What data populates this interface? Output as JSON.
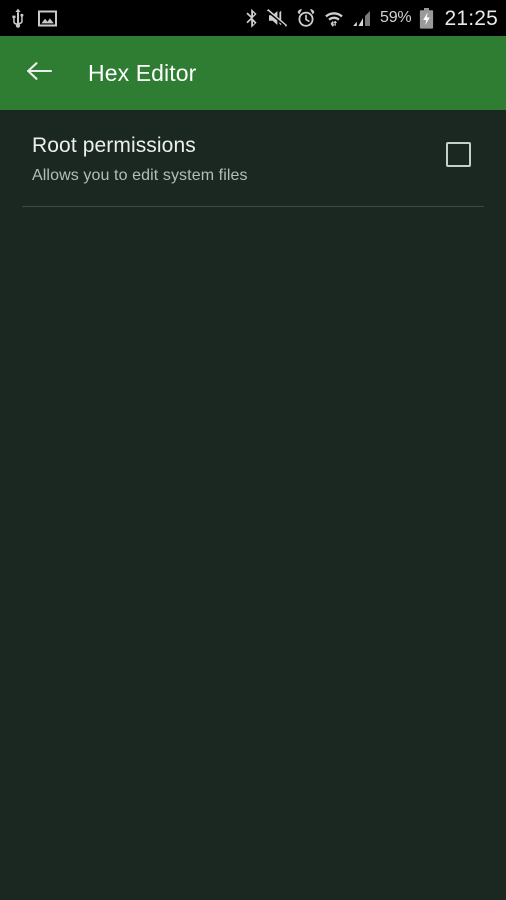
{
  "status_bar": {
    "left_icons": [
      {
        "name": "usb-icon",
        "label": "USB connected"
      },
      {
        "name": "image-icon",
        "label": "Screenshot captured"
      }
    ],
    "right_icons": [
      {
        "name": "bluetooth-icon",
        "label": "Bluetooth"
      },
      {
        "name": "mute-icon",
        "label": "Sound muted"
      },
      {
        "name": "alarm-icon",
        "label": "Alarm set"
      },
      {
        "name": "wifi-icon",
        "label": "Wi-Fi"
      },
      {
        "name": "cellular-signal-icon",
        "label": "Cellular signal"
      }
    ],
    "battery_percent": "59%",
    "battery_icon": "battery-charging-icon",
    "clock": "21:25",
    "background_color": "#000000"
  },
  "app_bar": {
    "back_icon": "arrow-back-icon",
    "title": "Hex Editor",
    "background_color": "#2E7D32",
    "text_color": "#FFFFFF"
  },
  "settings": {
    "items": [
      {
        "title": "Root permissions",
        "summary": "Allows you to edit system files",
        "control": "checkbox",
        "checked": false
      }
    ]
  },
  "theme": {
    "background_color": "#1B2821",
    "primary_text_color": "#ECEFF0",
    "secondary_text_color": "#B4BDB6",
    "divider_color": "#3C4A40",
    "checkbox_border_color": "#C7CFC9"
  }
}
